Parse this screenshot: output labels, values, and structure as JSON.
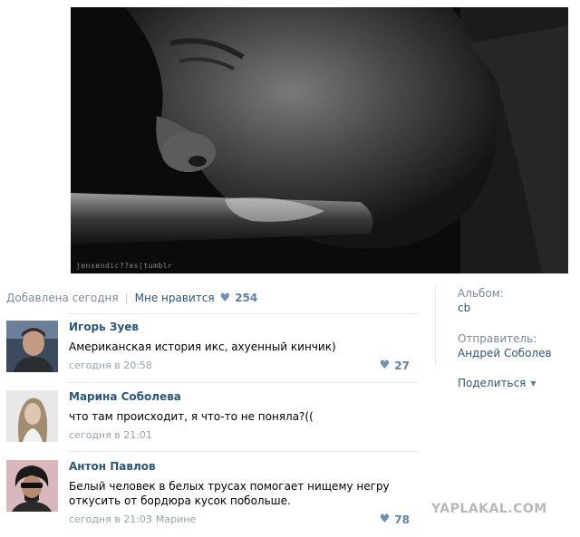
{
  "photo": {
    "watermark": "jensendic??es|tumblr"
  },
  "info": {
    "added": "Добавлена сегодня",
    "separator": "|",
    "like_label": "Мне нравится",
    "like_icon": "heart-icon",
    "like_count": "254"
  },
  "sidebar": {
    "album_label": "Альбом:",
    "album_value": "cb",
    "sender_label": "Отправитель:",
    "sender_value": "Андрей Соболев",
    "share_label": "Поделиться",
    "share_icon": "caret-down-icon"
  },
  "comments": [
    {
      "author": "Игорь Зуев",
      "text": "Американская история икс, ахуенный кинчик)",
      "time": "сегодня в 20:58",
      "reply_to": "",
      "likes": "27"
    },
    {
      "author": "Марина Соболева",
      "text": "что там происходит, я что-то не поняла?((",
      "time": "сегодня в 21:01",
      "reply_to": "",
      "likes": ""
    },
    {
      "author": "Антон Павлов",
      "text": "Белый человек в белых трусах помогает нищему негру откусить от бордюра кусок побольше.",
      "time": "сегодня в 21:03",
      "reply_to": "Марине",
      "likes": "78"
    }
  ],
  "site_watermark": "YAPLAKAL.COM",
  "colors": {
    "link": "#2b587a",
    "muted": "#7f8a96",
    "like_accent": "#5e80a8"
  }
}
